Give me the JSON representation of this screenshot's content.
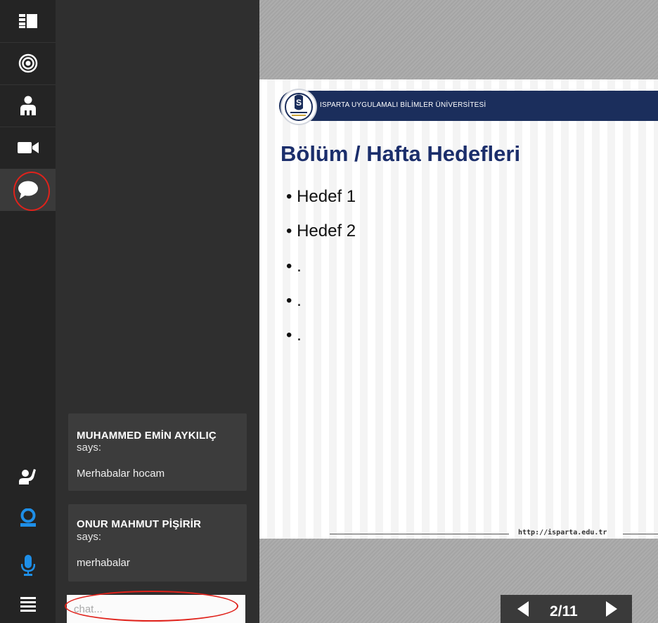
{
  "chat": {
    "messages": [
      {
        "author": "MUHAMMED EMİN AYKILIÇ",
        "says": "says:",
        "text": "Merhabalar hocam"
      },
      {
        "author": "ONUR MAHMUT PİŞİRİR",
        "says": "says:",
        "text": "merhabalar"
      }
    ],
    "input_placeholder": "chat..."
  },
  "slide": {
    "banner_text": "ISPARTA UYGULAMALI BİLİMLER ÜNİVERSİTESİ",
    "title": "Bölüm / Hafta Hedefleri",
    "bullets": [
      "• Hedef 1",
      "• Hedef 2",
      "• .",
      "• .",
      "• ."
    ],
    "footer_url": "http://isparta.edu.tr"
  },
  "pager": {
    "label": "2/11"
  },
  "colors": {
    "accent_blue": "#1e8fe8",
    "annotation_red": "#e0221b",
    "slide_title": "#1b2e6b"
  },
  "icons": {
    "rail_top": [
      "layout-icon",
      "broadcast-icon",
      "participants-icon",
      "video-camera-icon",
      "chat-bubble-icon"
    ],
    "rail_bottom": [
      "raise-hand-icon",
      "webcam-icon",
      "microphone-icon",
      "menu-icon"
    ]
  }
}
